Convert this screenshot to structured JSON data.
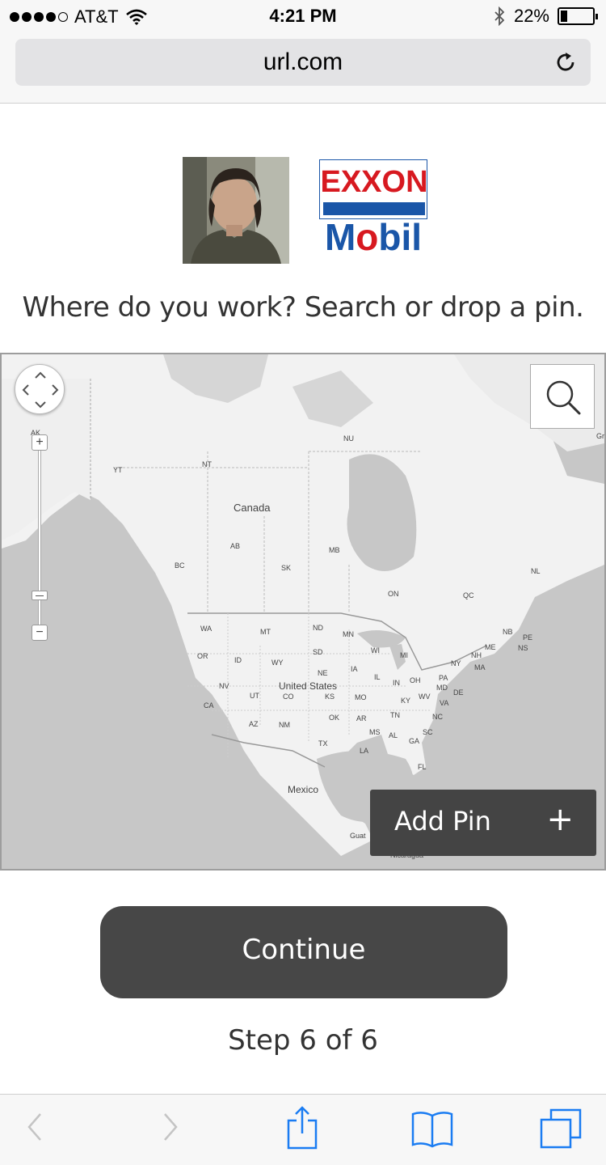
{
  "status_bar": {
    "carrier": "AT&T",
    "time": "4:21 PM",
    "battery_percent_text": "22%",
    "battery_level": 0.22,
    "signal_bars_filled": 4,
    "signal_bars_total": 5
  },
  "browser": {
    "url": "url.com"
  },
  "page": {
    "prompt": "Where do you work? Search or drop a pin.",
    "continue_label": "Continue",
    "step_text": "Step 6 of 6"
  },
  "logo": {
    "brand_top": "EXXON",
    "brand_bottom_before": "M",
    "brand_bottom_o": "o",
    "brand_bottom_after": "bil"
  },
  "map": {
    "add_pin_label": "Add Pin",
    "add_pin_icon": "+",
    "zoom_in_label": "+",
    "zoom_out_label": "−",
    "labels": {
      "canada": "Canada",
      "united_states": "United States",
      "mexico": "Mexico",
      "guatemala": "Guat",
      "nicaragua": "Nicaragua",
      "greenland": "Gr",
      "ak": "AK",
      "yt": "YT",
      "nt": "NT",
      "nu": "NU",
      "bc": "BC",
      "ab": "AB",
      "sk": "SK",
      "mb": "MB",
      "on": "ON",
      "qc": "QC",
      "nl": "NL",
      "nb": "NB",
      "pe": "PE",
      "ns": "NS",
      "wa": "WA",
      "mt": "MT",
      "nd": "ND",
      "mn": "MN",
      "or": "OR",
      "id": "ID",
      "wy": "WY",
      "sd": "SD",
      "wi": "WI",
      "mi": "MI",
      "me": "ME",
      "nh": "NH",
      "ny": "NY",
      "ma": "MA",
      "ia": "IA",
      "ne": "NE",
      "il": "IL",
      "in": "IN",
      "oh": "OH",
      "pa": "PA",
      "md": "MD",
      "de": "DE",
      "nv": "NV",
      "ut": "UT",
      "co": "CO",
      "ks": "KS",
      "mo": "MO",
      "ky": "KY",
      "wv": "WV",
      "va": "VA",
      "ca": "CA",
      "az": "AZ",
      "nm": "NM",
      "ok": "OK",
      "ar": "AR",
      "tn": "TN",
      "nc": "NC",
      "ms": "MS",
      "al": "AL",
      "ga": "GA",
      "sc": "SC",
      "tx": "TX",
      "la": "LA",
      "fl": "FL"
    }
  },
  "colors": {
    "button_dark": "#474747",
    "map_land": "#f2f2f2",
    "map_water": "#c7c7c7",
    "ios_blue": "#1a7cf2",
    "exxon_red": "#d71920",
    "mobil_blue": "#1a56a8"
  },
  "icons": {
    "reload": "reload-icon",
    "search": "search-icon",
    "back": "back-chevron-icon",
    "forward": "forward-chevron-icon",
    "share": "share-icon",
    "bookmarks": "bookmarks-icon",
    "tabs": "tabs-icon"
  }
}
